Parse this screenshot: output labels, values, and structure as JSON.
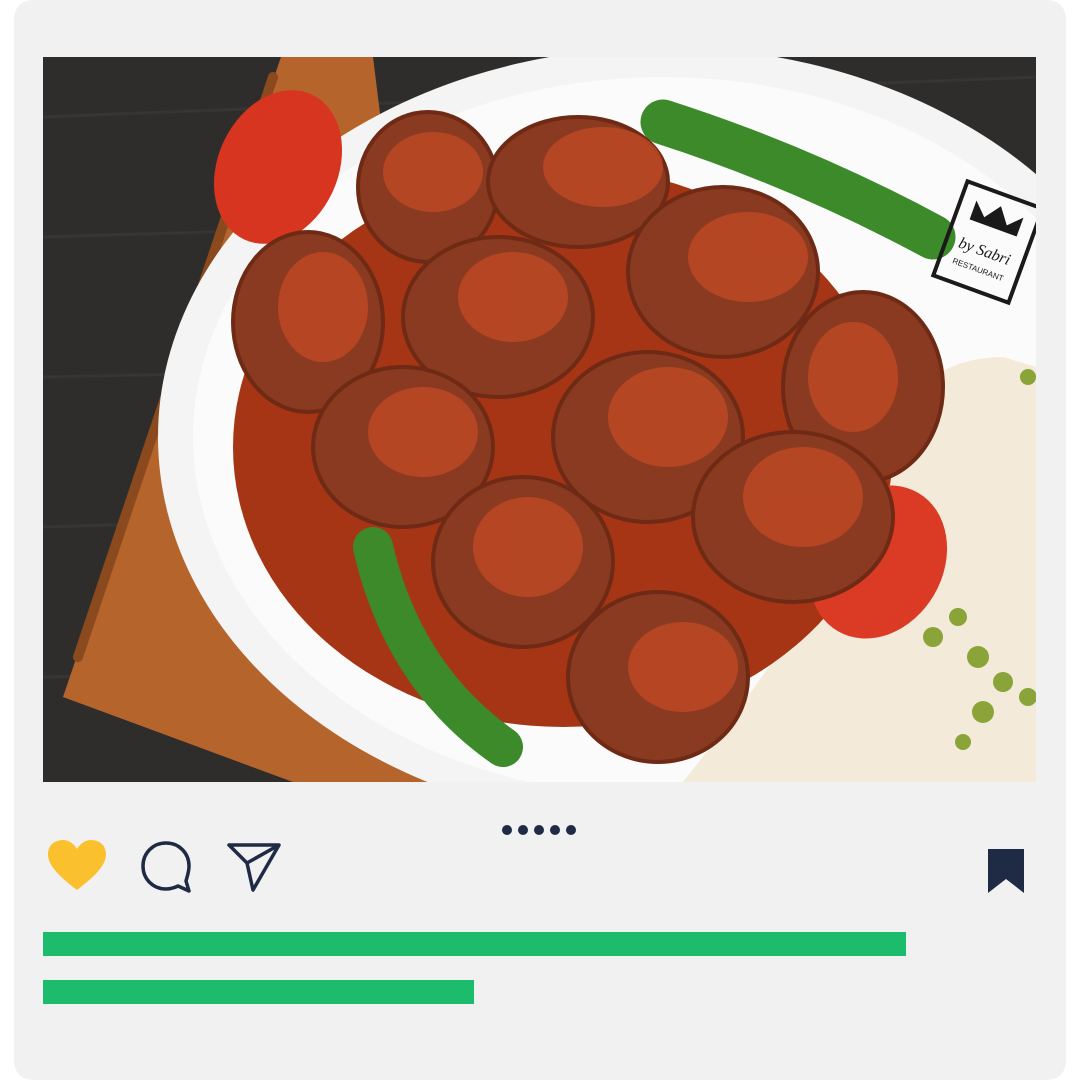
{
  "post": {
    "photo": {
      "brand_lines": [
        "by Sabri",
        "RESTAURANT"
      ]
    },
    "carousel": {
      "count": 5,
      "active_index": 0
    }
  },
  "actions": {
    "like": {
      "icon": "heart-icon",
      "liked": true
    },
    "comment": {
      "icon": "comment-icon"
    },
    "share": {
      "icon": "send-icon"
    },
    "save": {
      "icon": "bookmark-icon",
      "saved": true
    }
  },
  "caption_lines": [
    {
      "fraction": 0.863
    },
    {
      "fraction": 0.431
    }
  ],
  "colors": {
    "card_background": "#f1f1f1",
    "heart": "#fbc02d",
    "icon_stroke": "#1f2a44",
    "caption_bar": "#1dbb6c",
    "pager_dot": "#1f2a44"
  }
}
